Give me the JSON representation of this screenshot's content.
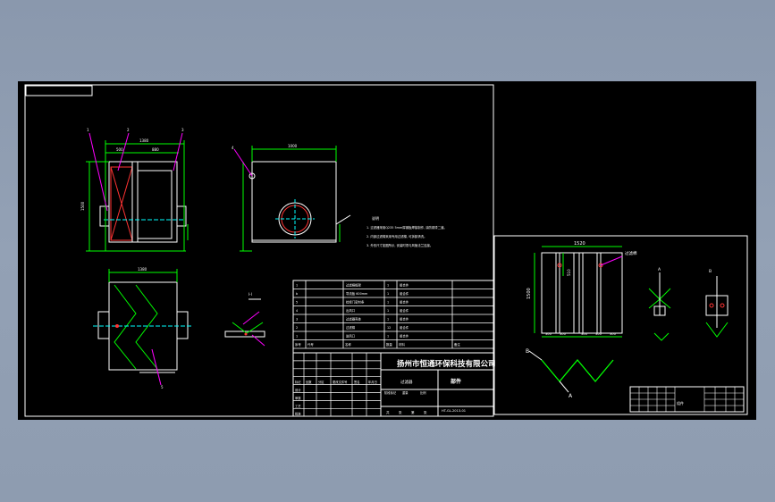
{
  "view1": {
    "dim_top_overall": "1380",
    "dim_top_left": "500",
    "dim_top_right": "880",
    "dim_left_height": "1500",
    "callouts": [
      "1",
      "2",
      "3"
    ]
  },
  "view2": {
    "dim_top": "1000",
    "callout": "4"
  },
  "view3": {
    "dim_top": "1380",
    "callout": "5"
  },
  "section": {
    "label": "I-I"
  },
  "notes": {
    "title": "说明",
    "lines": [
      "1. 过滤器采用Q235  5mm厚钢板焊接制作, 涂防锈漆二道。",
      "2. 内部过滤棉采用专用过滤棉, 可拆卸清洗。",
      "3. 外形尺寸如图所示, 安装时须与风管法兰连接。"
    ]
  },
  "parts": {
    "rows": [
      {
        "no": "1",
        "name": "过滤棉框架",
        "qty": "1",
        "mat": "组合件"
      },
      {
        "no": "b",
        "name": "导流板 600mm",
        "qty": "1",
        "mat": "组合件"
      },
      {
        "no": "5",
        "name": "检修门密封条",
        "qty": "1",
        "mat": "组合件"
      },
      {
        "no": "4",
        "name": "出风口",
        "qty": "1",
        "mat": "组合件"
      },
      {
        "no": "3",
        "name": "过滤器壳体",
        "qty": "1",
        "mat": "组合件"
      },
      {
        "no": "2",
        "name": "过滤棉",
        "qty": "12",
        "mat": "组合件"
      },
      {
        "no": "1",
        "name": "进风口",
        "qty": "1",
        "mat": "组合件"
      }
    ],
    "header": [
      "序号",
      "代号",
      "名称",
      "数量",
      "材料",
      "备注"
    ]
  },
  "titleblock": {
    "company": "扬州市恒通环保科技有限公司",
    "drawing_name": "过滤器",
    "label_parts": "部件",
    "row_labels": [
      "标记",
      "处数",
      "分区",
      "更改文件号",
      "签名",
      "年月日"
    ],
    "sub_labels": [
      "设计",
      "审核",
      "工艺",
      "批准"
    ],
    "stage_labels": [
      "阶段标记",
      "重量",
      "比例"
    ],
    "sheet_info": [
      "共",
      "张",
      "第",
      "张"
    ],
    "code": "HT-GL-2013-01"
  },
  "detail": {
    "dim_width": "1520",
    "dim_height": "1500",
    "dim_small": "510",
    "seg_dims": [
      "300",
      "300",
      "300",
      "300",
      "300"
    ],
    "label_b": "B",
    "label_a": "A",
    "label_a2": "A",
    "label_b2": "B",
    "tb_title": "过滤棉",
    "tb_sub": "组件"
  }
}
